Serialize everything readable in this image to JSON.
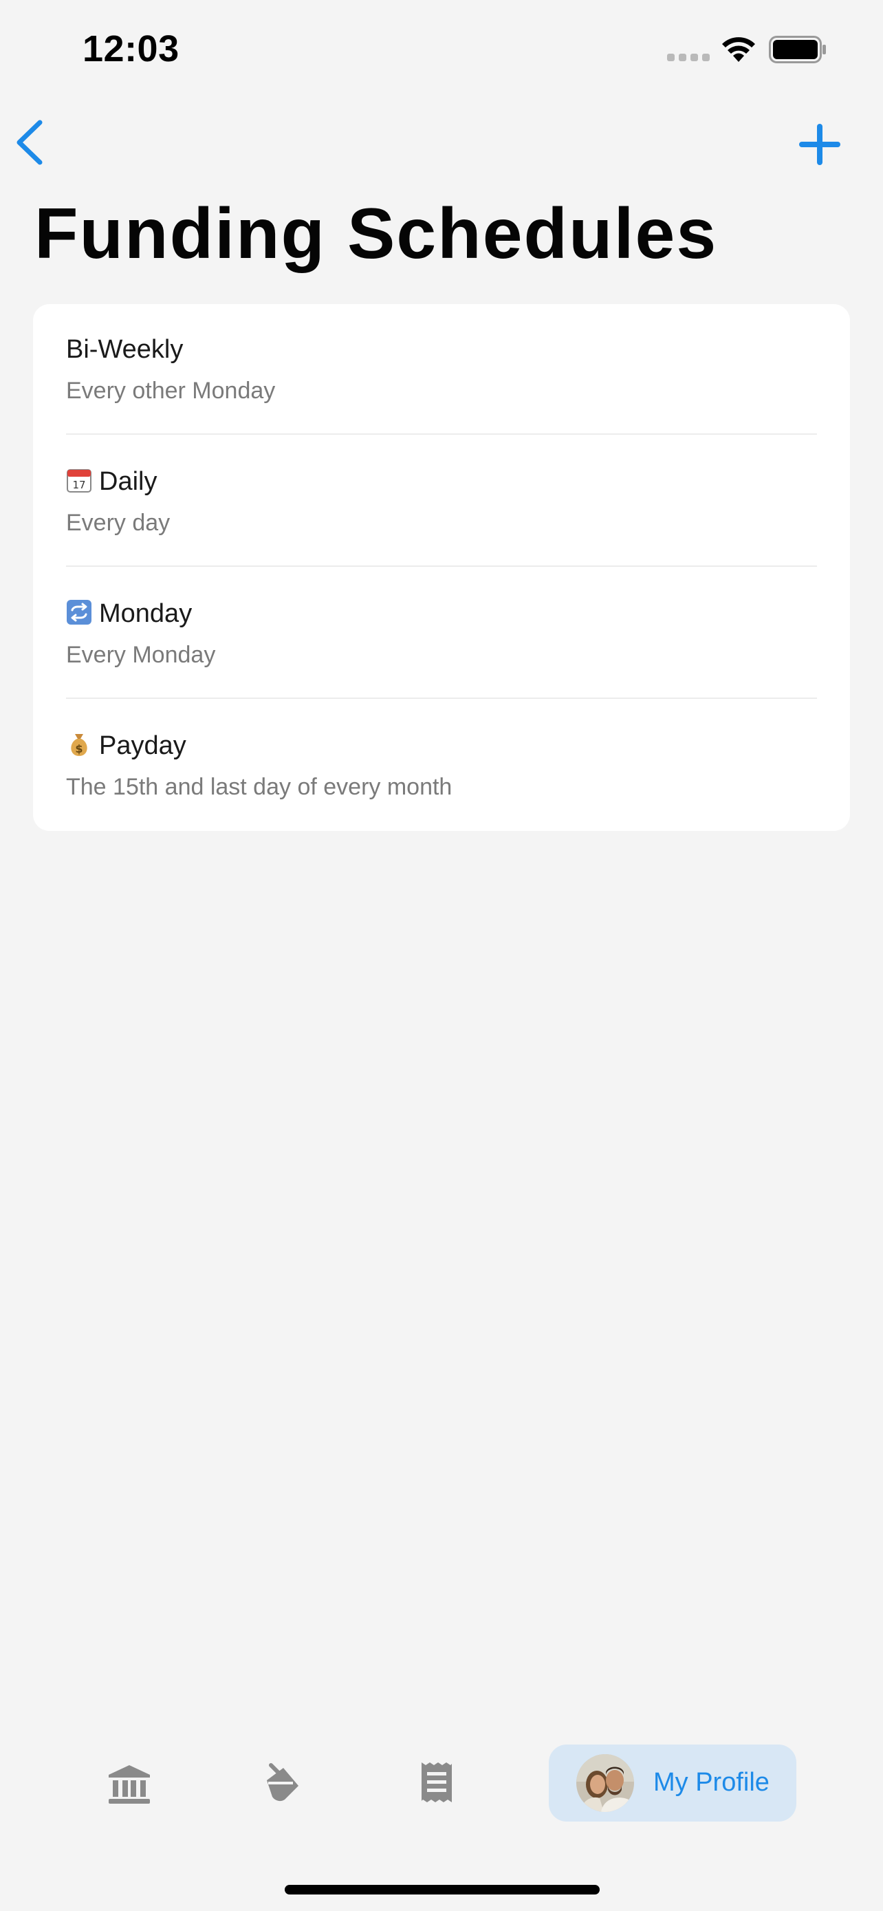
{
  "status_bar": {
    "time": "12:03"
  },
  "nav": {
    "back_icon": "chevron-left-icon",
    "add_icon": "plus-icon",
    "accent_color": "#1d8ae8"
  },
  "page": {
    "title": "Funding Schedules"
  },
  "schedules": [
    {
      "emoji": "",
      "title": "Bi-Weekly",
      "subtitle": "Every other Monday"
    },
    {
      "emoji": "calendar-emoji",
      "title": "Daily",
      "subtitle": "Every day"
    },
    {
      "emoji": "repeat-emoji",
      "title": "Monday",
      "subtitle": "Every Monday"
    },
    {
      "emoji": "money-bag-emoji",
      "title": "Payday",
      "subtitle": "The 15th and last day of every month"
    }
  ],
  "tab_bar": {
    "tabs": [
      {
        "icon": "bank-icon"
      },
      {
        "icon": "paint-bucket-icon"
      },
      {
        "icon": "receipt-icon"
      }
    ],
    "profile": {
      "label": "My Profile",
      "active": true
    }
  }
}
